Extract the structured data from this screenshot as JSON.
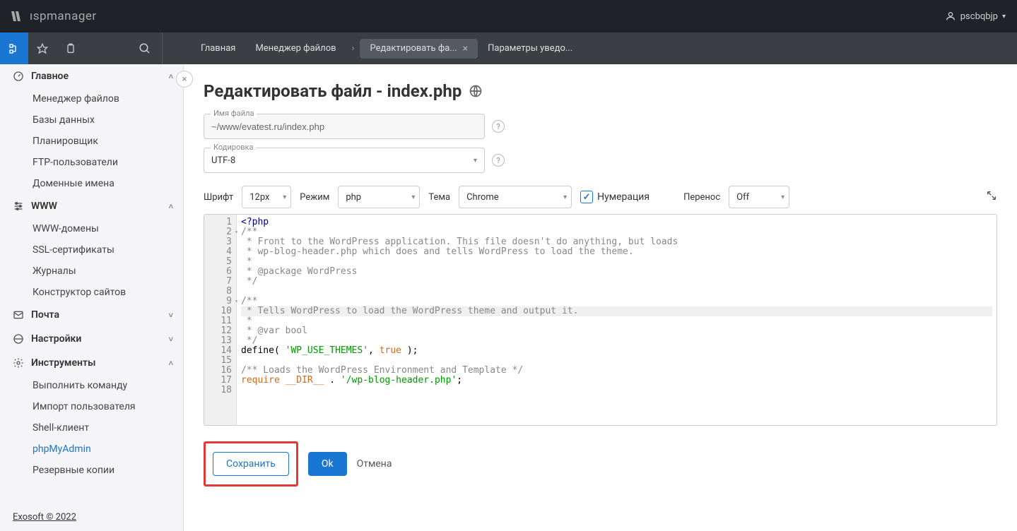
{
  "header": {
    "logo_text": "ıspmanager",
    "user": "pscbqbjp"
  },
  "breadcrumbs": [
    {
      "label": "Главная",
      "active": false
    },
    {
      "label": "Менеджер файлов",
      "active": false
    },
    {
      "label": "Редактировать фа...",
      "active": true,
      "closable": true
    },
    {
      "label": "Параметры уведо...",
      "active": false
    }
  ],
  "sidebar": [
    {
      "icon": "gauge",
      "label": "Главное",
      "expanded": true,
      "items": [
        "Менеджер файлов",
        "Базы данных",
        "Планировщик",
        "FTP-пользователи",
        "Доменные имена"
      ]
    },
    {
      "icon": "sliders",
      "label": "WWW",
      "expanded": true,
      "items": [
        "WWW-домены",
        "SSL-сертификаты",
        "Журналы",
        "Конструктор сайтов"
      ]
    },
    {
      "icon": "mail",
      "label": "Почта",
      "expanded": false,
      "items": []
    },
    {
      "icon": "globe",
      "label": "Настройки",
      "expanded": false,
      "items": []
    },
    {
      "icon": "gear",
      "label": "Инструменты",
      "expanded": true,
      "items": [
        "Выполнить команду",
        "Импорт пользователя",
        "Shell-клиент",
        "phpMyAdmin",
        "Резервные копии"
      ]
    }
  ],
  "sidebar_active": "phpMyAdmin",
  "footer": "Exosoft © 2022",
  "page": {
    "title": "Редактировать файл - index.php",
    "filename_label": "Имя файла",
    "filename_value": "~/www/evatest.ru/index.php",
    "encoding_label": "Кодировка",
    "encoding_value": "UTF-8",
    "font_label": "Шрифт",
    "font_value": "12px",
    "mode_label": "Режим",
    "mode_value": "php",
    "theme_label": "Тема",
    "theme_value": "Chrome",
    "numbering_label": "Нумерация",
    "wrap_label": "Перенос",
    "wrap_value": "Off"
  },
  "code": [
    {
      "n": 1,
      "html": "<span class='k-tag'>&lt;?php</span>"
    },
    {
      "n": 2,
      "fold": true,
      "html": "<span class='k-comment'>/**</span>"
    },
    {
      "n": 3,
      "html": "<span class='k-comment'> * Front to the WordPress application. This file doesn't do anything, but loads</span>"
    },
    {
      "n": 4,
      "html": "<span class='k-comment'> * wp-blog-header.php which does and tells WordPress to load the theme.</span>"
    },
    {
      "n": 5,
      "html": "<span class='k-comment'> *</span>"
    },
    {
      "n": 6,
      "html": "<span class='k-comment'> * </span><span class='k-ann'>@package</span><span class='k-comment'> WordPress</span>"
    },
    {
      "n": 7,
      "html": "<span class='k-comment'> */</span>"
    },
    {
      "n": 8,
      "html": ""
    },
    {
      "n": 9,
      "fold": true,
      "html": "<span class='k-comment'>/**</span>"
    },
    {
      "n": 10,
      "hl": true,
      "html": "<span class='k-comment'> * Tells WordPress to load the WordPress theme and output it.</span>"
    },
    {
      "n": 11,
      "html": "<span class='k-comment'> *</span>"
    },
    {
      "n": 12,
      "html": "<span class='k-comment'> * </span><span class='k-ann'>@var</span><span class='k-comment'> bool</span>"
    },
    {
      "n": 13,
      "html": "<span class='k-comment'> */</span>"
    },
    {
      "n": 14,
      "html": "<span class='k-func'>define</span><span class='k-punc'>( </span><span class='k-str'>'WP_USE_THEMES'</span><span class='k-punc'>, </span><span class='k-const'>true</span><span class='k-punc'> );</span>"
    },
    {
      "n": 15,
      "html": ""
    },
    {
      "n": 16,
      "html": "<span class='k-comment'>/** Loads the WordPress Environment and Template */</span>"
    },
    {
      "n": 17,
      "html": "<span class='k-const'>require</span> <span class='k-const'>__DIR__</span> <span class='k-punc'>.</span> <span class='k-str'>'/wp-blog-header.php'</span><span class='k-punc'>;</span>"
    },
    {
      "n": 18,
      "html": ""
    }
  ],
  "actions": {
    "save": "Сохранить",
    "ok": "Ok",
    "cancel": "Отмена"
  }
}
